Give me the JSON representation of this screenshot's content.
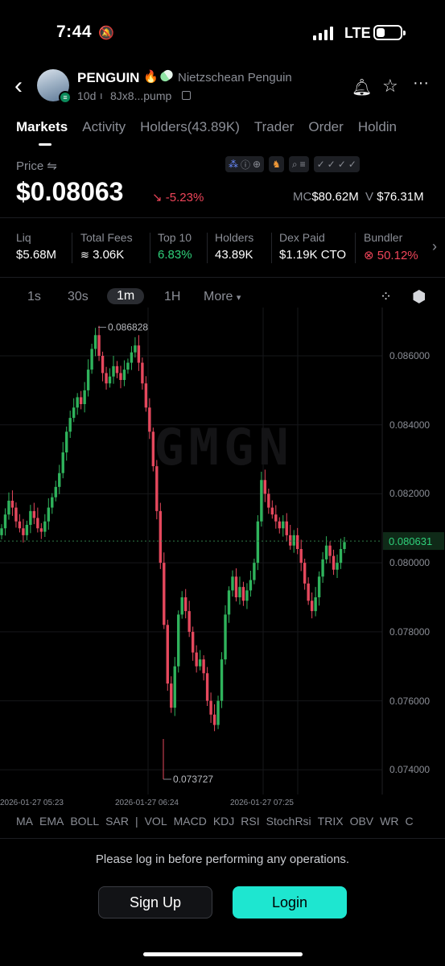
{
  "status_bar": {
    "time": "7:44",
    "network": "LTE"
  },
  "token": {
    "symbol": "PENGUIN",
    "full_name": "Nietzschean Penguin",
    "age": "10d",
    "address": "8Jx8...pump"
  },
  "icons": {
    "back": "chevron-left-icon",
    "bell": "bell-icon",
    "star": "star-icon",
    "more": "more-icon",
    "copy": "copy-icon",
    "flame": "flame-icon",
    "swap": "swap-icon"
  },
  "tabs": [
    "Markets",
    "Activity",
    "Holders(43.89K)",
    "Trader",
    "Order",
    "Holdin"
  ],
  "price": {
    "label": "Price",
    "value": "$0.08063",
    "change": "-5.23%",
    "mc_label": "MC",
    "mc_value": "$80.62M",
    "v_label": "V",
    "v_value": "$76.31M"
  },
  "stats": [
    {
      "label": "Liq",
      "value": "$5.68M"
    },
    {
      "label": "Total Fees",
      "value": "3.06K"
    },
    {
      "label": "Top 10",
      "value": "6.83%"
    },
    {
      "label": "Holders",
      "value": "43.89K"
    },
    {
      "label": "Dex Paid",
      "value": "$1.19K CTO"
    },
    {
      "label": "Bundler",
      "value": "50.12%"
    }
  ],
  "timeframes": [
    "1s",
    "30s",
    "1m",
    "1H",
    "More"
  ],
  "active_timeframe": "1m",
  "chart_data": {
    "type": "candlestick",
    "watermark": "GMGN",
    "y_ticks": [
      "0.086000",
      "0.084000",
      "0.082000",
      "0.080000",
      "0.078000",
      "0.076000",
      "0.074000"
    ],
    "ylim": [
      0.0734,
      0.0874
    ],
    "x_ticks": [
      "2026-01-27 05:23",
      "2026-01-27 06:24",
      "2026-01-27 07:25"
    ],
    "high_label": "0.086828",
    "low_label": "0.073727",
    "current_price_label": "0.080631",
    "current_price": 0.080631,
    "up_color": "#2fb35c",
    "down_color": "#e5485d",
    "candles_close_series": [
      0.081,
      0.0814,
      0.0818,
      0.0816,
      0.0812,
      0.081,
      0.0808,
      0.0811,
      0.0815,
      0.0813,
      0.081,
      0.0809,
      0.0812,
      0.0816,
      0.0819,
      0.0822,
      0.0826,
      0.0832,
      0.0838,
      0.0842,
      0.0845,
      0.0848,
      0.0846,
      0.085,
      0.0856,
      0.0862,
      0.0866,
      0.086,
      0.0855,
      0.0852,
      0.0854,
      0.0857,
      0.0855,
      0.0853,
      0.0856,
      0.0858,
      0.0861,
      0.0863,
      0.0858,
      0.0852,
      0.0845,
      0.0838,
      0.0828,
      0.0815,
      0.08,
      0.0782,
      0.0765,
      0.0758,
      0.077,
      0.0785,
      0.079,
      0.0786,
      0.078,
      0.0774,
      0.077,
      0.0772,
      0.0768,
      0.076,
      0.0756,
      0.0753,
      0.076,
      0.0772,
      0.0785,
      0.0792,
      0.0796,
      0.079,
      0.0793,
      0.0789,
      0.0792,
      0.0795,
      0.08,
      0.0812,
      0.0824,
      0.082,
      0.0816,
      0.0814,
      0.0812,
      0.081,
      0.0812,
      0.0808,
      0.0805,
      0.0808,
      0.0804,
      0.08,
      0.0794,
      0.0789,
      0.0786,
      0.079,
      0.0796,
      0.0801,
      0.0805,
      0.0802,
      0.0798,
      0.08,
      0.0804,
      0.0806
    ]
  },
  "indicators": [
    "MA",
    "EMA",
    "BOLL",
    "SAR",
    "|",
    "VOL",
    "MACD",
    "KDJ",
    "RSI",
    "StochRsi",
    "TRIX",
    "OBV",
    "WR",
    "C"
  ],
  "login_notice": "Please log in before performing any operations.",
  "buttons": {
    "signup": "Sign Up",
    "login": "Login"
  }
}
